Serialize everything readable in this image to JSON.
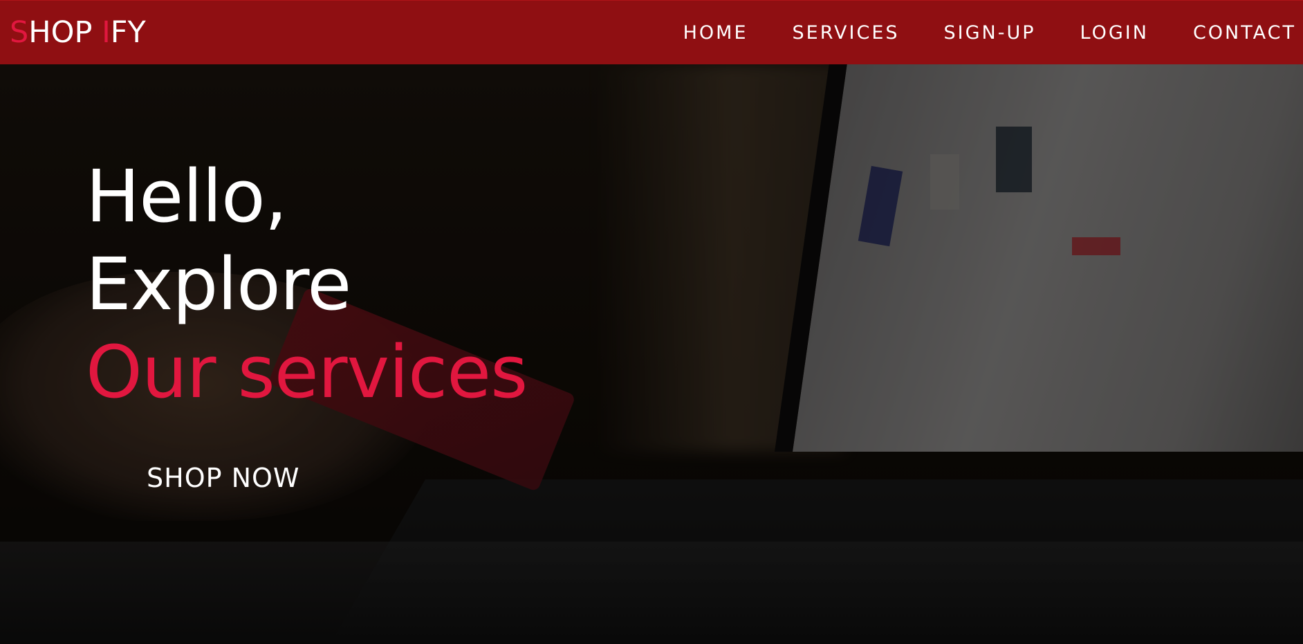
{
  "brand": {
    "logo_s": "S",
    "logo_hop": "HOP ",
    "logo_i": "I",
    "logo_fy": "FY",
    "accent_color": "#e1173f",
    "nav_bg_color": "#8f0f12"
  },
  "nav": {
    "items": [
      {
        "label": "HOME"
      },
      {
        "label": "SERVICES"
      },
      {
        "label": "SIGN-UP"
      },
      {
        "label": "LOGIN"
      },
      {
        "label": "CONTACT"
      }
    ]
  },
  "hero": {
    "line1": "Hello,",
    "line2": "Explore",
    "line3": "Our services",
    "cta_label": "SHOP NOW",
    "background_image": "laptop-shopping-photo"
  }
}
